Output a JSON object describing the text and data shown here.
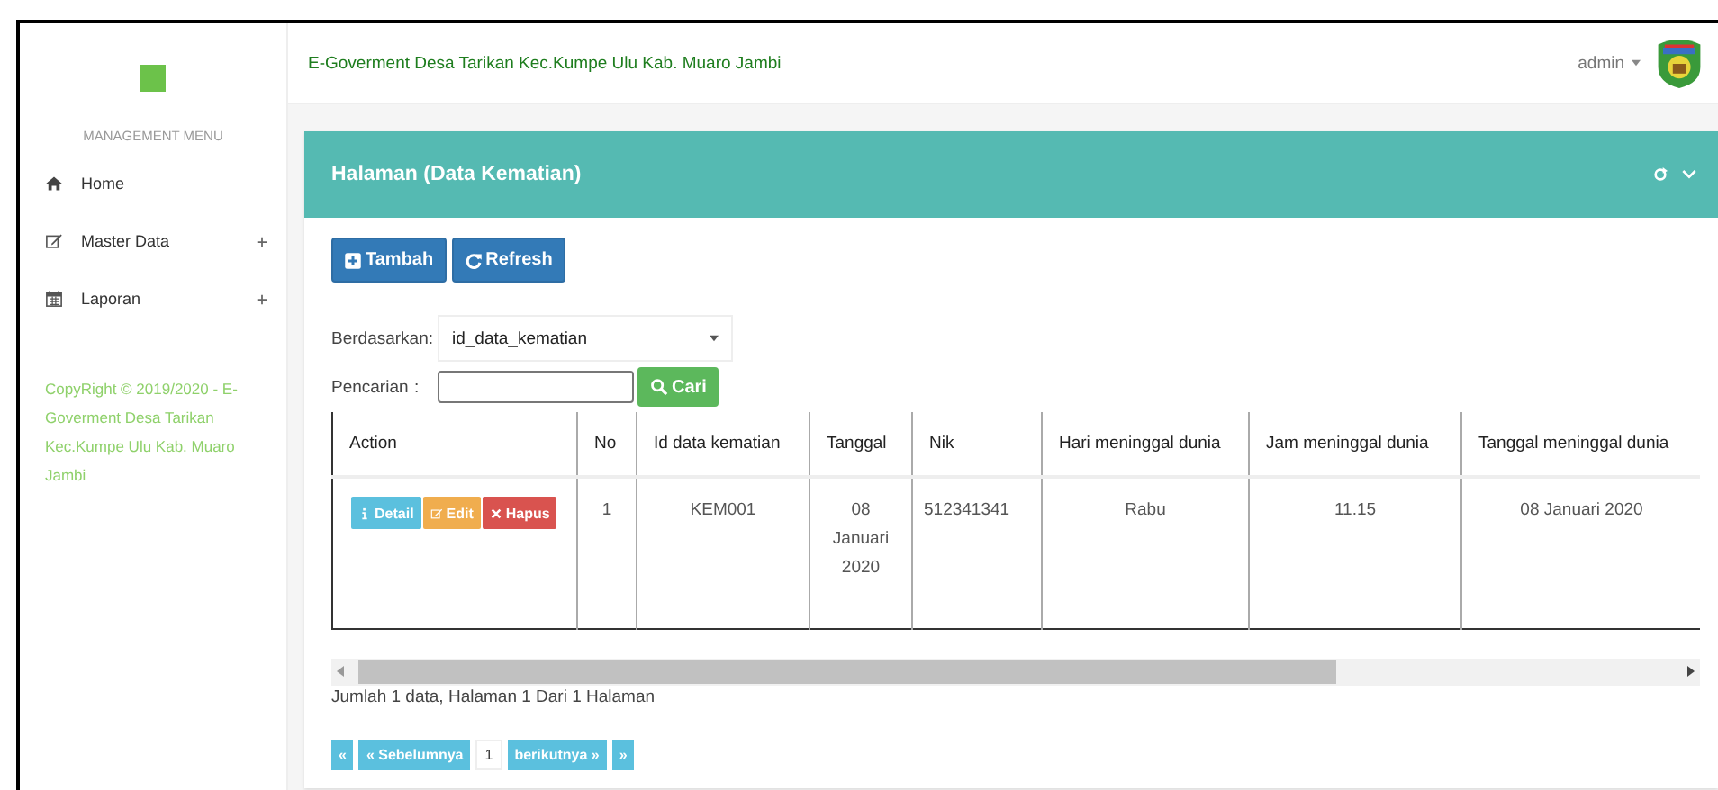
{
  "header": {
    "title": "E-Goverment Desa Tarikan Kec.Kumpe Ulu Kab. Muaro Jambi",
    "user": "admin"
  },
  "sidebar": {
    "heading": "MANAGEMENT MENU",
    "items": [
      {
        "label": "Home",
        "expandable": false
      },
      {
        "label": "Master Data",
        "expandable": true
      },
      {
        "label": "Laporan",
        "expandable": true
      }
    ],
    "footer": "CopyRight © 2019/2020 - E-Goverment Desa Tarikan Kec.Kumpe Ulu Kab. Muaro Jambi"
  },
  "panel": {
    "title": "Halaman (Data Kematian)",
    "toolbar": [
      "Tambah",
      "Refresh"
    ],
    "filter": {
      "label": "Berdasarkan:",
      "value": "id_data_kematian"
    },
    "search": {
      "label": "Pencarian",
      "separator": ":",
      "button": "Cari"
    },
    "table": {
      "columns": [
        "Action",
        "No",
        "Id data kematian",
        "Tanggal",
        "Nik",
        "Hari meninggal dunia",
        "Jam meninggal dunia",
        "Tanggal meninggal dunia"
      ],
      "rows": [
        {
          "cells": [
            {
              "actions": [
                {
                  "label": "Detail",
                  "kind": "info"
                },
                {
                  "label": "Edit",
                  "kind": "warning"
                },
                {
                  "label": "Hapus",
                  "kind": "danger"
                }
              ]
            },
            "1",
            "KEM001",
            "08 Januari 2020",
            "512341341",
            "Rabu",
            "11.15",
            "08 Januari 2020"
          ]
        }
      ]
    },
    "summary": "Jumlah 1 data, Halaman 1 Dari 1 Halaman",
    "pagination": [
      {
        "label": "«",
        "selected": false
      },
      {
        "label": "« Sebelumnya",
        "selected": false
      },
      {
        "label": "1",
        "selected": true
      },
      {
        "label": "berikutnya »",
        "selected": false
      },
      {
        "label": "»",
        "selected": false
      }
    ]
  }
}
